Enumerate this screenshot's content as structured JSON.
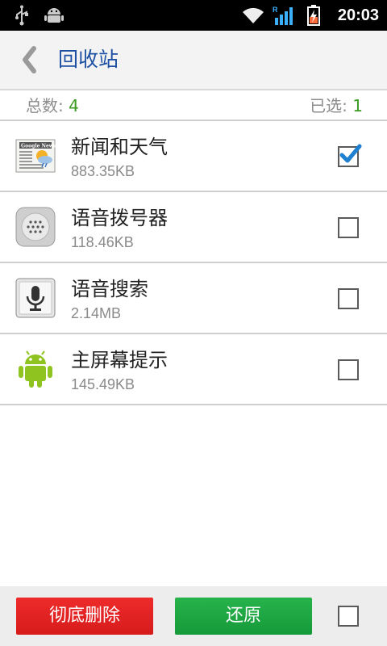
{
  "status_bar": {
    "time": "20:03",
    "icons": [
      "usb-icon",
      "android-debug-icon",
      "wifi-icon",
      "signal-roaming-icon",
      "battery-charging-icon"
    ]
  },
  "header": {
    "title": "回收站"
  },
  "summary": {
    "total_label": "总数:",
    "total_value": "4",
    "selected_label": "已选:",
    "selected_value": "1"
  },
  "apps": [
    {
      "name": "新闻和天气",
      "size": "883.35KB",
      "checked": true,
      "icon": "news-weather-icon"
    },
    {
      "name": "语音拨号器",
      "size": "118.46KB",
      "checked": false,
      "icon": "voice-dialer-icon"
    },
    {
      "name": "语音搜索",
      "size": "2.14MB",
      "checked": false,
      "icon": "voice-search-icon"
    },
    {
      "name": "主屏幕提示",
      "size": "145.49KB",
      "checked": false,
      "icon": "android-icon"
    }
  ],
  "footer": {
    "delete_label": "彻底删除",
    "restore_label": "还原",
    "select_all_checked": false
  },
  "colors": {
    "title": "#1d4fa3",
    "count": "#3a9a22",
    "delete_button": "#e02020",
    "restore_button": "#1ea842",
    "check": "#1f7fd0"
  }
}
